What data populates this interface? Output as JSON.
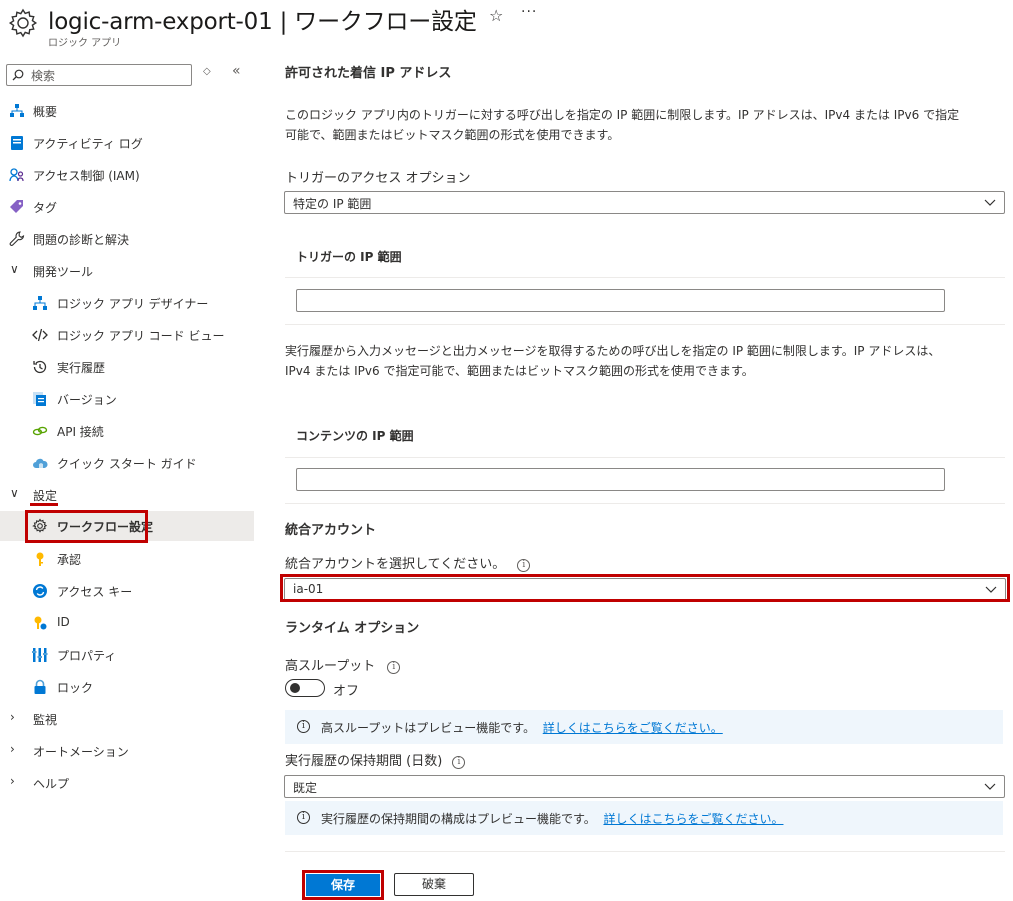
{
  "header": {
    "title": "logic-arm-export-01 | ワークフロー設定",
    "subtitle": "ロジック アプリ",
    "star_icon": "star-icon",
    "more_label": "···"
  },
  "sidebar": {
    "search_placeholder": "検索",
    "collapse_label": "«",
    "sort_label": "◇",
    "items": [
      {
        "label": "概要",
        "icon": "overview-icon"
      },
      {
        "label": "アクティビティ ログ",
        "icon": "activity-log-icon"
      },
      {
        "label": "アクセス制御 (IAM)",
        "icon": "iam-icon"
      },
      {
        "label": "タグ",
        "icon": "tag-icon"
      },
      {
        "label": "問題の診断と解決",
        "icon": "wrench-icon"
      }
    ],
    "dev_group": "開発ツール",
    "dev_items": [
      {
        "label": "ロジック アプリ デザイナー"
      },
      {
        "label": "ロジック アプリ コード ビュー"
      },
      {
        "label": "実行履歴"
      },
      {
        "label": "バージョン"
      },
      {
        "label": "API 接続"
      },
      {
        "label": "クイック スタート ガイド"
      }
    ],
    "settings_group": "設定",
    "settings_items": [
      {
        "label": "ワークフロー設定",
        "selected": true
      },
      {
        "label": "承認"
      },
      {
        "label": "アクセス キー"
      },
      {
        "label": "ID"
      },
      {
        "label": "プロパティ"
      },
      {
        "label": "ロック"
      }
    ],
    "collapsed_groups": [
      "監視",
      "オートメーション",
      "ヘルプ"
    ]
  },
  "main": {
    "inbound_title": "許可された着信 IP アドレス",
    "inbound_desc_1": "このロジック アプリ内のトリガーに対する呼び出しを指定の IP 範囲に制限します。IP アドレスは、IPv4 または IPv6 で指定",
    "inbound_desc_2": "可能で、範囲またはビットマスク範囲の形式を使用できます。",
    "trigger_access_label": "トリガーのアクセス オプション",
    "trigger_access_value": "特定の IP 範囲",
    "trigger_ip_title": "トリガーの IP 範囲",
    "trigger_ip_value": "",
    "history_desc_1": "実行履歴から入力メッセージと出力メッセージを取得するための呼び出しを指定の IP 範囲に制限します。IP アドレスは、",
    "history_desc_2": "IPv4 または IPv6 で指定可能で、範囲またはビットマスク範囲の形式を使用できます。",
    "content_ip_title": "コンテンツの IP 範囲",
    "content_ip_value": "",
    "integration_title": "統合アカウント",
    "integration_label": "統合アカウントを選択してください。",
    "integration_value": "ia-01",
    "runtime_title": "ランタイム オプション",
    "throughput_label": "高スループット",
    "throughput_state": "オフ",
    "throughput_on": false,
    "throughput_info": "高スループットはプレビュー機能です。",
    "throughput_link": "詳しくはこちらをご覧ください。",
    "retention_label": "実行履歴の保持期間 (日数)",
    "retention_value": "既定",
    "retention_info": "実行履歴の保持期間の構成はプレビュー機能です。",
    "retention_link": "詳しくはこちらをご覧ください。",
    "save_label": "保存",
    "discard_label": "破棄",
    "info_glyph": "i"
  },
  "colors": {
    "accent": "#0078d4",
    "highlight_red": "#c00000",
    "info_bg": "#eff6fc"
  }
}
